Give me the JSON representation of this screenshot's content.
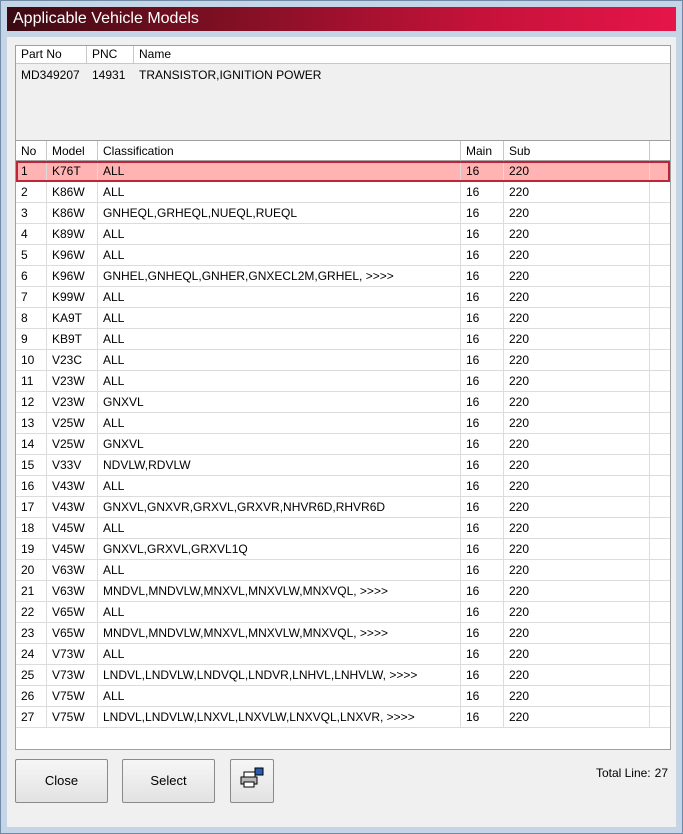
{
  "window": {
    "title": "Applicable Vehicle Models"
  },
  "part": {
    "headers": [
      "Part No",
      "PNC",
      "Name"
    ],
    "part_no": "MD349207",
    "pnc": "14931",
    "name": "TRANSISTOR,IGNITION POWER"
  },
  "grid": {
    "headers": [
      "No",
      "Model",
      "Classification",
      "Main",
      "Sub"
    ],
    "selected_index": 0,
    "rows": [
      [
        "1",
        "K76T",
        "ALL",
        "16",
        "220"
      ],
      [
        "2",
        "K86W",
        "ALL",
        "16",
        "220"
      ],
      [
        "3",
        "K86W",
        "GNHEQL,GRHEQL,NUEQL,RUEQL",
        "16",
        "220"
      ],
      [
        "4",
        "K89W",
        "ALL",
        "16",
        "220"
      ],
      [
        "5",
        "K96W",
        "ALL",
        "16",
        "220"
      ],
      [
        "6",
        "K96W",
        "GNHEL,GNHEQL,GNHER,GNXECL2M,GRHEL,  >>>>",
        "16",
        "220"
      ],
      [
        "7",
        "K99W",
        "ALL",
        "16",
        "220"
      ],
      [
        "8",
        "KA9T",
        "ALL",
        "16",
        "220"
      ],
      [
        "9",
        "KB9T",
        "ALL",
        "16",
        "220"
      ],
      [
        "10",
        "V23C",
        "ALL",
        "16",
        "220"
      ],
      [
        "11",
        "V23W",
        "ALL",
        "16",
        "220"
      ],
      [
        "12",
        "V23W",
        "GNXVL",
        "16",
        "220"
      ],
      [
        "13",
        "V25W",
        "ALL",
        "16",
        "220"
      ],
      [
        "14",
        "V25W",
        "GNXVL",
        "16",
        "220"
      ],
      [
        "15",
        "V33V",
        "NDVLW,RDVLW",
        "16",
        "220"
      ],
      [
        "16",
        "V43W",
        "ALL",
        "16",
        "220"
      ],
      [
        "17",
        "V43W",
        "GNXVL,GNXVR,GRXVL,GRXVR,NHVR6D,RHVR6D",
        "16",
        "220"
      ],
      [
        "18",
        "V45W",
        "ALL",
        "16",
        "220"
      ],
      [
        "19",
        "V45W",
        "GNXVL,GRXVL,GRXVL1Q",
        "16",
        "220"
      ],
      [
        "20",
        "V63W",
        "ALL",
        "16",
        "220"
      ],
      [
        "21",
        "V63W",
        "MNDVL,MNDVLW,MNXVL,MNXVLW,MNXVQL,  >>>>",
        "16",
        "220"
      ],
      [
        "22",
        "V65W",
        "ALL",
        "16",
        "220"
      ],
      [
        "23",
        "V65W",
        "MNDVL,MNDVLW,MNXVL,MNXVLW,MNXVQL,  >>>>",
        "16",
        "220"
      ],
      [
        "24",
        "V73W",
        "ALL",
        "16",
        "220"
      ],
      [
        "25",
        "V73W",
        "LNDVL,LNDVLW,LNDVQL,LNDVR,LNHVL,LNHVLW,  >>>>",
        "16",
        "220"
      ],
      [
        "26",
        "V75W",
        "ALL",
        "16",
        "220"
      ],
      [
        "27",
        "V75W",
        "LNDVL,LNDVLW,LNXVL,LNXVLW,LNXVQL,LNXVR,  >>>>",
        "16",
        "220"
      ]
    ]
  },
  "buttons": {
    "close": "Close",
    "select": "Select",
    "print_icon": "printer-icon"
  },
  "footer": {
    "total_label": "Total Line:",
    "total_value": "27"
  },
  "colors": {
    "title_start": "#3a0a12",
    "title_end": "#e6154a",
    "selected_row": "#ffb3b3",
    "selected_border": "#c0243a"
  }
}
